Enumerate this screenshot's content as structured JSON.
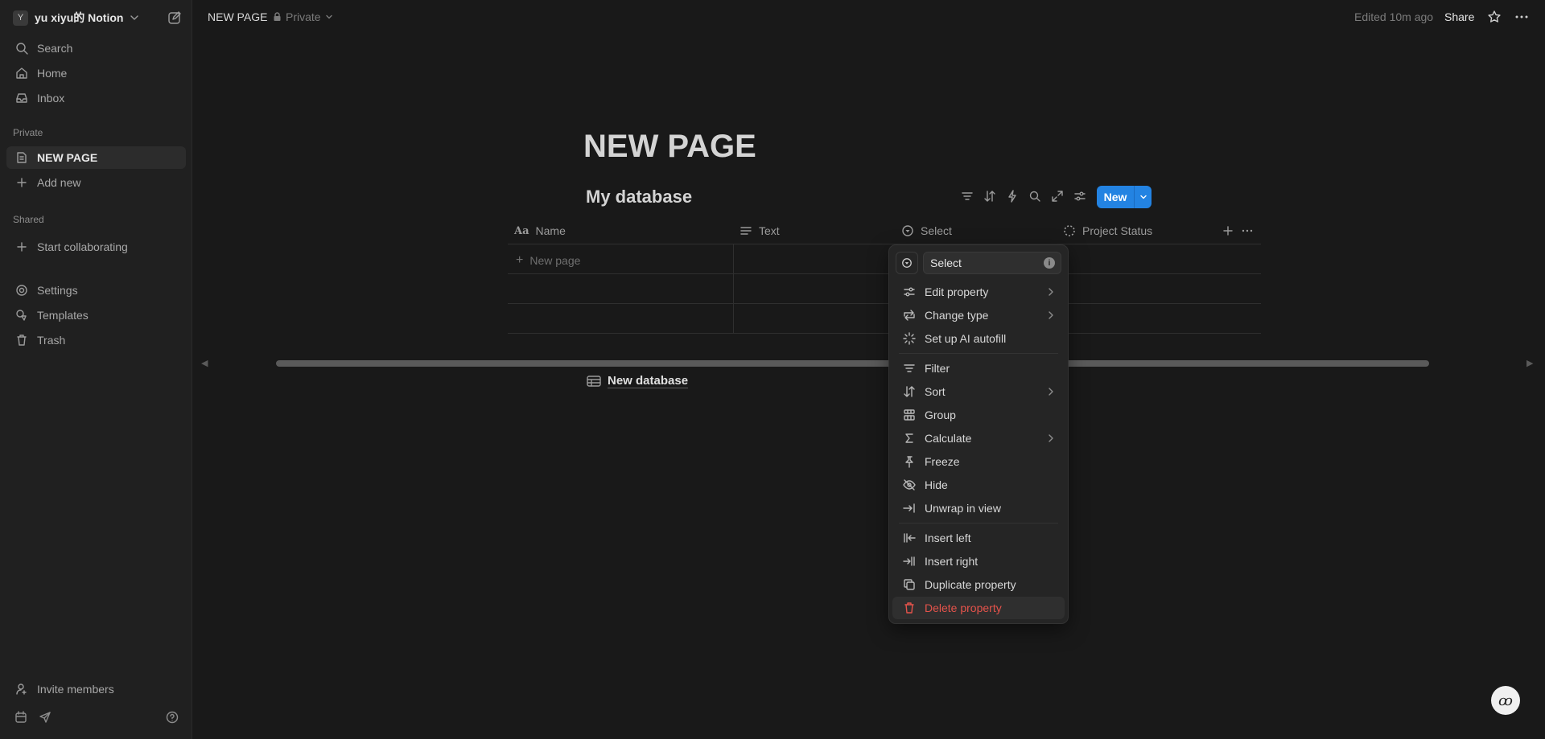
{
  "sidebar": {
    "workspace": {
      "avatar_letter": "Y",
      "name": "yu xiyu的 Notion"
    },
    "nav": [
      {
        "label": "Search",
        "icon": "search-icon"
      },
      {
        "label": "Home",
        "icon": "home-icon"
      },
      {
        "label": "Inbox",
        "icon": "inbox-icon"
      }
    ],
    "private_label": "Private",
    "private_items": [
      {
        "label": "NEW PAGE",
        "icon": "page-icon",
        "active": true
      },
      {
        "label": "Add new",
        "icon": "plus-icon"
      }
    ],
    "shared_label": "Shared",
    "shared_items": [
      {
        "label": "Start collaborating",
        "icon": "plus-icon"
      }
    ],
    "settings_items": [
      {
        "label": "Settings",
        "icon": "gear-icon"
      },
      {
        "label": "Templates",
        "icon": "templates-icon"
      },
      {
        "label": "Trash",
        "icon": "trash-icon"
      }
    ],
    "invite_label": "Invite members"
  },
  "topbar": {
    "breadcrumb": "NEW PAGE",
    "privacy": "Private",
    "edited": "Edited 10m ago",
    "share": "Share"
  },
  "page": {
    "title": "NEW PAGE",
    "database_title": "My database",
    "new_button": "New",
    "columns": [
      {
        "label": "Name",
        "icon": "title-icon"
      },
      {
        "label": "Text",
        "icon": "text-lines-icon"
      },
      {
        "label": "Select",
        "icon": "select-icon"
      },
      {
        "label": "Project Status",
        "icon": "status-icon"
      }
    ],
    "new_row_label": "New page",
    "linked_database": "New database"
  },
  "menu": {
    "property_name": "Select",
    "items": [
      {
        "label": "Edit property",
        "icon": "sliders-icon",
        "submenu": true
      },
      {
        "label": "Change type",
        "icon": "change-type-icon",
        "submenu": true
      },
      {
        "label": "Set up AI autofill",
        "icon": "sparkle-icon",
        "submenu": false
      },
      {
        "label": "Filter",
        "icon": "filter-icon",
        "submenu": false
      },
      {
        "label": "Sort",
        "icon": "sort-icon",
        "submenu": true
      },
      {
        "label": "Group",
        "icon": "group-icon",
        "submenu": false
      },
      {
        "label": "Calculate",
        "icon": "sigma-icon",
        "submenu": true
      },
      {
        "label": "Freeze",
        "icon": "pin-icon",
        "submenu": false
      },
      {
        "label": "Hide",
        "icon": "eye-off-icon",
        "submenu": false
      },
      {
        "label": "Unwrap in view",
        "icon": "unwrap-icon",
        "submenu": false
      },
      {
        "label": "Insert left",
        "icon": "insert-left-icon",
        "submenu": false
      },
      {
        "label": "Insert right",
        "icon": "insert-right-icon",
        "submenu": false
      },
      {
        "label": "Duplicate property",
        "icon": "duplicate-icon",
        "submenu": false
      },
      {
        "label": "Delete property",
        "icon": "trash-icon",
        "submenu": false
      }
    ]
  },
  "colors": {
    "accent": "#2383e2",
    "danger": "#e5534b",
    "background": "#191919",
    "sidebar": "#202020"
  }
}
